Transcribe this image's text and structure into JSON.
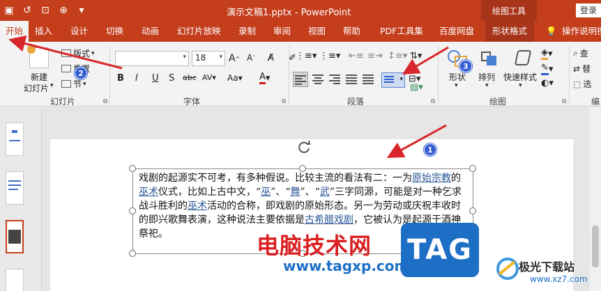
{
  "window": {
    "title": "演示文稿1.pptx - PowerPoint",
    "context_tools_label": "绘图工具",
    "login_label": "登录"
  },
  "tabs": [
    {
      "label": "开始"
    },
    {
      "label": "插入"
    },
    {
      "label": "设计"
    },
    {
      "label": "切换"
    },
    {
      "label": "动画"
    },
    {
      "label": "幻灯片放映"
    },
    {
      "label": "录制"
    },
    {
      "label": "审阅"
    },
    {
      "label": "视图"
    },
    {
      "label": "帮助"
    },
    {
      "label": "PDF工具集"
    },
    {
      "label": "百度网盘"
    },
    {
      "label": "形状格式"
    }
  ],
  "tell_me": "操作说明搜",
  "ribbon": {
    "slides_group": {
      "label": "幻灯片",
      "new_slide_line1": "新建",
      "new_slide_line2": "幻灯片",
      "layout": "版式",
      "reset": "重置",
      "section": "节"
    },
    "font_group": {
      "label": "字体",
      "font_name": "",
      "font_size": "18"
    },
    "paragraph_group": {
      "label": "段落"
    },
    "drawing_group": {
      "label": "绘图",
      "shapes": "形状",
      "arrange": "排列",
      "quick_styles": "快速样式"
    },
    "editing_group": {
      "label": "编",
      "find": "查",
      "replace": "替",
      "select": "选"
    }
  },
  "textbox": {
    "t1": "戏剧的起源实不可考，有多种假说。比较主流的看法有二：一为",
    "l1": "原始宗教",
    "t2": "的",
    "l2": "巫术",
    "t3": "仪式，比如上古中文，“",
    "l3": "巫",
    "t4": "”、“",
    "l4": "舞",
    "t5": "”、“",
    "l5": "武",
    "t6": "”三字同源，可能是对一种乞求战斗胜利的",
    "l6": "巫术",
    "t7": "活动的合称，即戏剧的原始形态。另一为劳动或庆祝丰收时的即兴歌舞表演，这种说法主要依据是",
    "l7": "古希腊戏剧",
    "t8": "，它被认为是起源于酒神祭祀。"
  },
  "annotations": {
    "badge1": "1",
    "badge2": "2",
    "badge3": "3"
  },
  "watermark": {
    "site_cn": "电脑技术网",
    "tag": "TAG",
    "url": "www.tagxp.com",
    "brand": "极光下载站",
    "brand_url": "www.xz7.com"
  },
  "colors": {
    "accent": "#c43e1c",
    "hyperlink": "#2b5797",
    "annotation_arrow": "#d8262b",
    "badge": "#2f5bd0"
  }
}
